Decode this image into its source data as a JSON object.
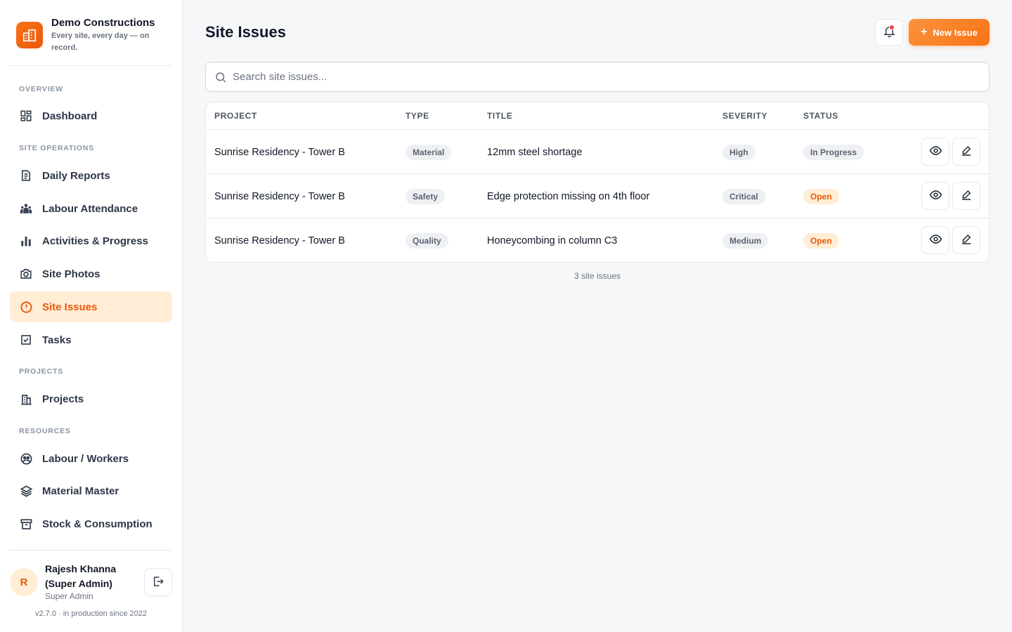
{
  "brand": {
    "name": "Demo Constructions",
    "tagline": "Every site, every day — on record."
  },
  "sidebar": {
    "sections": [
      {
        "label": "OVERVIEW"
      },
      {
        "label": "SITE OPERATIONS"
      },
      {
        "label": "PROJECTS"
      },
      {
        "label": "RESOURCES"
      }
    ],
    "items": [
      {
        "label": "Dashboard",
        "icon": "dashboard-icon"
      },
      {
        "label": "Daily Reports",
        "icon": "report-icon"
      },
      {
        "label": "Labour Attendance",
        "icon": "users-icon"
      },
      {
        "label": "Activities & Progress",
        "icon": "bar-chart-icon"
      },
      {
        "label": "Site Photos",
        "icon": "camera-icon"
      },
      {
        "label": "Site Issues",
        "icon": "alert-icon",
        "active": true
      },
      {
        "label": "Tasks",
        "icon": "checkbox-icon"
      },
      {
        "label": "Projects",
        "icon": "building-icon"
      },
      {
        "label": "Labour / Workers",
        "icon": "workers-icon"
      },
      {
        "label": "Material Master",
        "icon": "layers-icon"
      },
      {
        "label": "Stock & Consumption",
        "icon": "archive-icon"
      }
    ]
  },
  "user": {
    "initial": "R",
    "name": "Rajesh Khanna (Super Admin)",
    "role": "Super Admin",
    "version": "v2.7.0 · in production since 2022"
  },
  "header": {
    "title": "Site Issues",
    "new_button": "New Issue"
  },
  "search": {
    "placeholder": "Search site issues...",
    "value": ""
  },
  "table": {
    "columns": [
      "PROJECT",
      "TYPE",
      "TITLE",
      "SEVERITY",
      "STATUS"
    ],
    "rows": [
      {
        "project": "Sunrise Residency - Tower B",
        "type": "Material",
        "title": "12mm steel shortage",
        "severity": "High",
        "status": "In Progress"
      },
      {
        "project": "Sunrise Residency - Tower B",
        "type": "Safety",
        "title": "Edge protection missing on 4th floor",
        "severity": "Critical",
        "status": "Open"
      },
      {
        "project": "Sunrise Residency - Tower B",
        "type": "Quality",
        "title": "Honeycombing in column C3",
        "severity": "Medium",
        "status": "Open"
      }
    ]
  },
  "footer_count": "3 site issues",
  "colors": {
    "accent": "#f97316",
    "active_bg": "#ffedd5",
    "notification": "#ef4444"
  }
}
